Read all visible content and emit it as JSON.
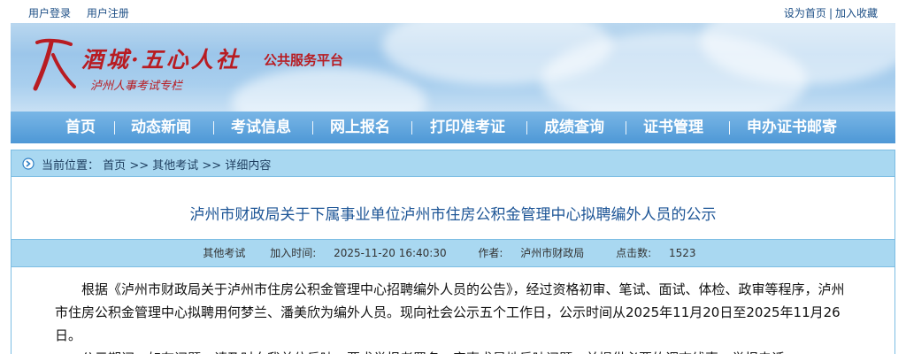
{
  "topbar": {
    "login": "用户登录",
    "register": "用户注册",
    "set_home": "设为首页",
    "separator": "|",
    "add_favorite": "加入收藏"
  },
  "banner": {
    "brand": "酒城·五心人社",
    "platform": "公共服务平台",
    "subtitle": "泸州人事考试专栏",
    "brand_color": "#b81c22"
  },
  "nav": {
    "items": [
      "首页",
      "动态新闻",
      "考试信息",
      "网上报名",
      "打印准考证",
      "成绩查询",
      "证书管理",
      "申办证书邮寄"
    ],
    "divider": "|"
  },
  "breadcrumb": {
    "prefix": "当前位置：",
    "home": "首页",
    "sep": ">>",
    "category": "其他考试",
    "current": "详细内容"
  },
  "article": {
    "title": "泸州市财政局关于下属事业单位泸州市住房公积金管理中心拟聘编外人员的公示",
    "meta": {
      "category": "其他考试",
      "time_label": "加入时间:",
      "time": "2025-11-20 16:40:30",
      "author_label": "作者:",
      "author": "泸州市财政局",
      "clicks_label": "点击数:",
      "clicks": "1523"
    },
    "paragraphs": [
      "根据《泸州市财政局关于泸州市住房公积金管理中心招聘编外人员的公告》，经过资格初审、笔试、面试、体检、政审等程序，泸州市住房公积金管理中心拟聘用何梦兰、潘美欣为编外人员。现向社会公示五个工作日，公示时间从2025年11月20日至2025年11月26日。",
      "公示期间，如有问题，请及时向我单位反映，要求举报者署名，实事求是地反映问题，并提供必要的调查线索，举报电话："
    ]
  }
}
